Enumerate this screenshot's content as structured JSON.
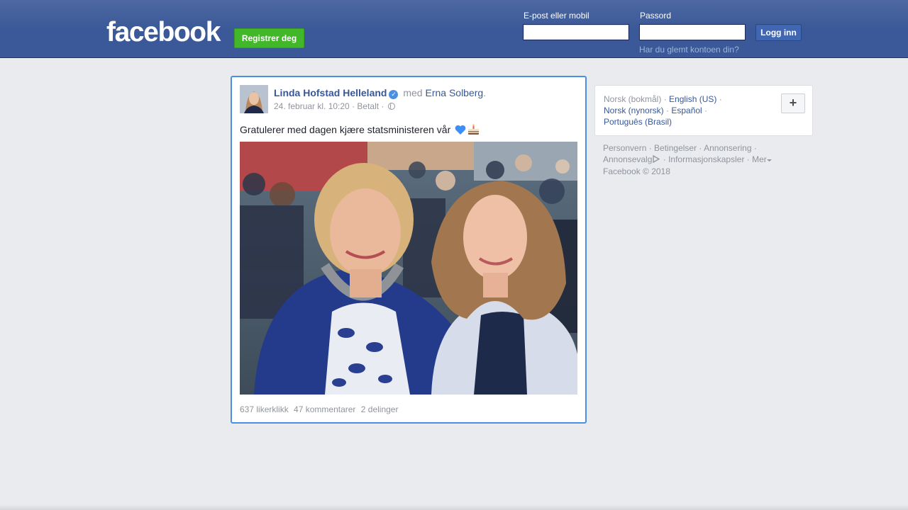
{
  "header": {
    "logo": "facebook",
    "register_label": "Registrer deg",
    "email_label": "E-post eller mobil",
    "email_value": "",
    "password_label": "Passord",
    "password_value": "",
    "login_label": "Logg inn",
    "forgot_link": "Har du glemt kontoen din?"
  },
  "post": {
    "author": "Linda Hofstad Helleland",
    "with_word": "med",
    "with_name": "Erna Solberg",
    "timestamp": "24. februar kl. 10:20",
    "paid": "Betalt",
    "text": "Gratulerer med dagen kjære statsministeren vår",
    "likes": "637 likerklikk",
    "comments": "47 kommentarer",
    "shares": "2 delinger"
  },
  "languages": {
    "current": "Norsk (bokmål)",
    "links": [
      "English (US)",
      "Norsk (nynorsk)",
      "Español",
      "Português (Brasil)"
    ],
    "add_label": "+"
  },
  "footer": {
    "privacy": "Personvern",
    "terms": "Betingelser",
    "advertising": "Annonsering",
    "adchoices": "Annonsevalg",
    "cookies": "Informasjonskapsler",
    "more": "Mer",
    "copyright": "Facebook © 2018"
  },
  "colors": {
    "header_blue": "#3b5998",
    "register_green": "#42b72a",
    "link_blue": "#365899",
    "highlight_border": "#4a90e2"
  },
  "icons": [
    "verified-icon",
    "globe-icon",
    "blue-heart-icon",
    "cake-icon",
    "adchoices-icon",
    "dropdown-arrow-icon"
  ]
}
